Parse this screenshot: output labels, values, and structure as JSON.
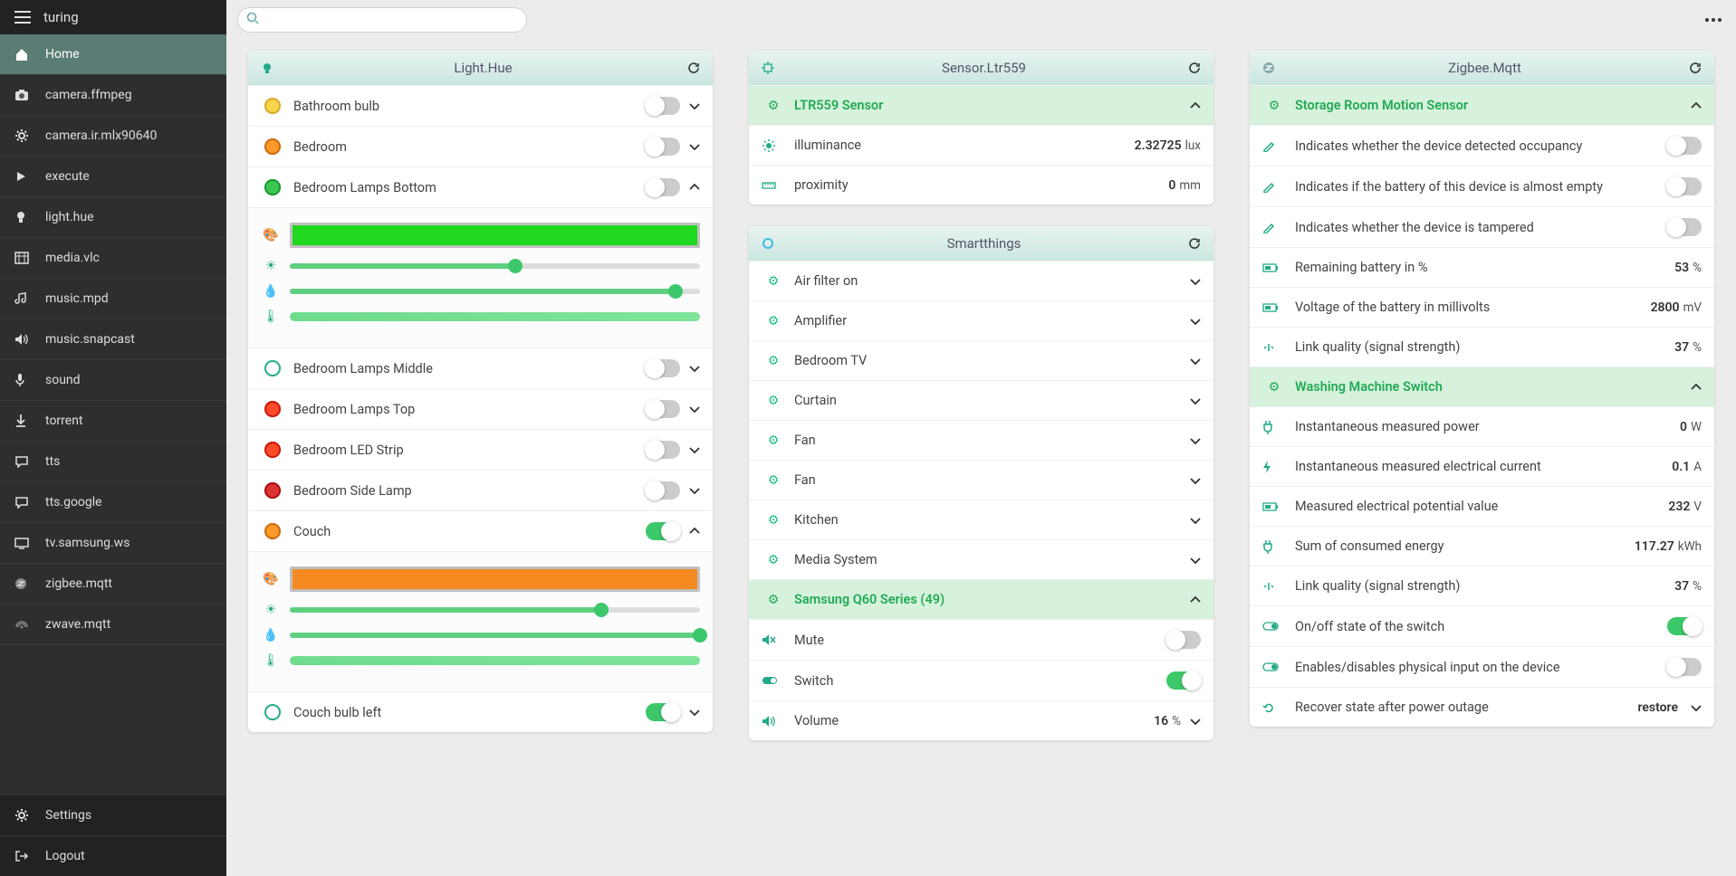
{
  "app_title": "turing",
  "sidebar": {
    "items": [
      {
        "icon": "home",
        "label": "Home",
        "active": true
      },
      {
        "icon": "camera",
        "label": "camera.ffmpeg"
      },
      {
        "icon": "gear",
        "label": "camera.ir.mlx90640"
      },
      {
        "icon": "play",
        "label": "execute"
      },
      {
        "icon": "bulb",
        "label": "light.hue"
      },
      {
        "icon": "media",
        "label": "media.vlc"
      },
      {
        "icon": "music",
        "label": "music.mpd"
      },
      {
        "icon": "volume",
        "label": "music.snapcast"
      },
      {
        "icon": "mic",
        "label": "sound"
      },
      {
        "icon": "torrent",
        "label": "torrent"
      },
      {
        "icon": "chat",
        "label": "tts"
      },
      {
        "icon": "chat",
        "label": "tts.google"
      },
      {
        "icon": "tv",
        "label": "tv.samsung.ws"
      },
      {
        "icon": "zigbee",
        "label": "zigbee.mqtt"
      },
      {
        "icon": "zwave",
        "label": "zwave.mqtt"
      }
    ],
    "footer": [
      {
        "icon": "gear",
        "label": "Settings"
      },
      {
        "icon": "logout",
        "label": "Logout"
      }
    ]
  },
  "search": {
    "placeholder": ""
  },
  "panels": {
    "light_hue": {
      "title": "Light.Hue",
      "items": [
        {
          "label": "Bathroom bulb",
          "bulb": "on-yellow",
          "on": false,
          "expanded": false
        },
        {
          "label": "Bedroom",
          "bulb": "on-orange",
          "on": false,
          "expanded": false
        },
        {
          "label": "Bedroom Lamps Bottom",
          "bulb": "on-green",
          "on": false,
          "expanded": true,
          "color": "#1fd81f",
          "sliders": [
            55,
            94,
            100
          ]
        },
        {
          "label": "Bedroom Lamps Middle",
          "bulb": "off",
          "on": false,
          "expanded": false
        },
        {
          "label": "Bedroom Lamps Top",
          "bulb": "on-red",
          "on": false,
          "expanded": false
        },
        {
          "label": "Bedroom LED Strip",
          "bulb": "on-red",
          "on": false,
          "expanded": false
        },
        {
          "label": "Bedroom Side Lamp",
          "bulb": "warn",
          "on": false,
          "expanded": false
        },
        {
          "label": "Couch",
          "bulb": "on-orange",
          "on": true,
          "expanded": true,
          "color": "#f58a20",
          "sliders": [
            76,
            100,
            100
          ]
        },
        {
          "label": "Couch bulb left",
          "bulb": "off",
          "on": true,
          "expanded": false
        }
      ]
    },
    "sensor": {
      "title": "Sensor.Ltr559",
      "section": "LTR559 Sensor",
      "rows": [
        {
          "icon": "sun",
          "label": "illuminance",
          "value": "2.32725",
          "unit": "lux"
        },
        {
          "icon": "ruler",
          "label": "proximity",
          "value": "0",
          "unit": "mm"
        }
      ]
    },
    "smartthings": {
      "title": "Smartthings",
      "items": [
        {
          "label": "Air filter on"
        },
        {
          "label": "Amplifier"
        },
        {
          "label": "Bedroom TV"
        },
        {
          "label": "Curtain"
        },
        {
          "label": "Fan"
        },
        {
          "label": "Fan"
        },
        {
          "label": "Kitchen"
        },
        {
          "label": "Media System"
        }
      ],
      "samsung": {
        "title": "Samsung Q60 Series (49)",
        "mute": {
          "label": "Mute",
          "on": false
        },
        "switch": {
          "label": "Switch",
          "on": true
        },
        "volume": {
          "label": "Volume",
          "value": "16",
          "unit": "%"
        }
      }
    },
    "zigbee": {
      "title": "Zigbee.Mqtt",
      "motion": {
        "title": "Storage Room Motion Sensor",
        "rows": [
          {
            "icon": "pencil",
            "label": "Indicates whether the device detected occupancy",
            "toggle": false
          },
          {
            "icon": "pencil",
            "label": "Indicates if the battery of this device is almost empty",
            "toggle": false
          },
          {
            "icon": "pencil",
            "label": "Indicates whether the device is tampered",
            "toggle": false
          },
          {
            "icon": "battery",
            "label": "Remaining battery in %",
            "value": "53",
            "unit": "%"
          },
          {
            "icon": "battery",
            "label": "Voltage of the battery in millivolts",
            "value": "2800",
            "unit": "mV"
          },
          {
            "icon": "signal",
            "label": "Link quality (signal strength)",
            "value": "37",
            "unit": "%"
          }
        ]
      },
      "washing": {
        "title": "Washing Machine Switch",
        "rows": [
          {
            "icon": "plug",
            "label": "Instantaneous measured power",
            "value": "0",
            "unit": "W"
          },
          {
            "icon": "bolt",
            "label": "Instantaneous measured electrical current",
            "value": "0.1",
            "unit": "A"
          },
          {
            "icon": "battery",
            "label": "Measured electrical potential value",
            "value": "232",
            "unit": "V"
          },
          {
            "icon": "plug",
            "label": "Sum of consumed energy",
            "value": "117.27",
            "unit": "kWh"
          },
          {
            "icon": "signal",
            "label": "Link quality (signal strength)",
            "value": "37",
            "unit": "%"
          },
          {
            "icon": "toggle",
            "label": "On/off state of the switch",
            "toggle": true
          },
          {
            "icon": "toggle",
            "label": "Enables/disables physical input on the device",
            "toggle": false
          },
          {
            "icon": "restore",
            "label": "Recover state after power outage",
            "dropdown": "restore"
          }
        ]
      }
    }
  }
}
